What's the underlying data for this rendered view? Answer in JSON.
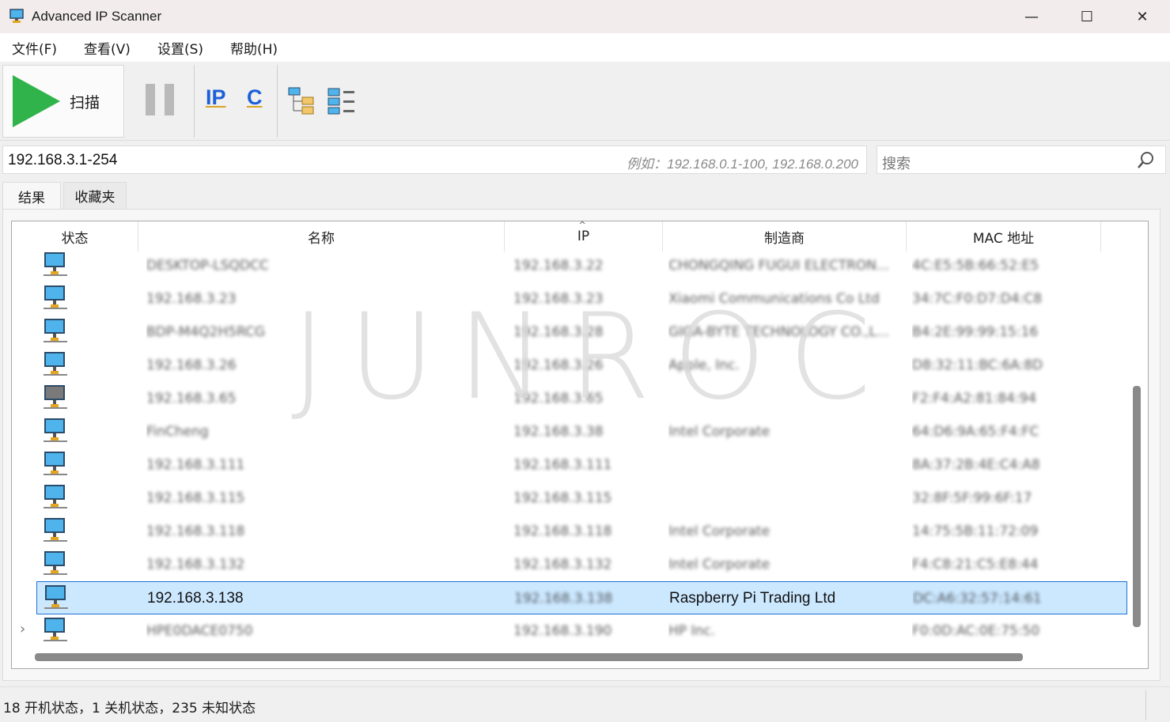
{
  "window": {
    "title": "Advanced IP Scanner",
    "minimize": "—",
    "maximize": "☐",
    "close": "✕"
  },
  "menu": [
    "文件(F)",
    "查看(V)",
    "设置(S)",
    "帮助(H)"
  ],
  "toolbar": {
    "scan_label": "扫描",
    "ip_icon": "IP",
    "c_icon": "C",
    "icons": [
      "play-icon",
      "pause-icon",
      "ip-icon",
      "c-subnet-icon",
      "tree-view-icon",
      "list-view-icon"
    ]
  },
  "ip_input": {
    "value": "192.168.3.1-254",
    "hint": "例如：192.168.0.1-100, 192.168.0.200"
  },
  "search": {
    "placeholder": "搜索"
  },
  "tabs": [
    "结果",
    "收藏夹"
  ],
  "table": {
    "columns": [
      "状态",
      "名称",
      "IP",
      "制造商",
      "MAC 地址"
    ],
    "sort_indicator": "^",
    "rows": [
      {
        "status": "on",
        "name": "DESKTOP-LSQDCC",
        "ip": "192.168.3.22",
        "vendor": "CHONGQING FUGUI ELECTRON...",
        "mac": "4C:E5:5B:66:52:E5"
      },
      {
        "status": "on",
        "name": "192.168.3.23",
        "ip": "192.168.3.23",
        "vendor": "Xiaomi Communications Co Ltd",
        "mac": "34:7C:F0:D7:D4:C8"
      },
      {
        "status": "on",
        "name": "BDP-M4Q2H5RCG",
        "ip": "192.168.3.28",
        "vendor": "GIGA-BYTE TECHNOLOGY CO.,L...",
        "mac": "B4:2E:99:99:15:16"
      },
      {
        "status": "on",
        "name": "192.168.3.26",
        "ip": "192.168.3.26",
        "vendor": "Apple, Inc.",
        "mac": "D8:32:11:BC:6A:8D"
      },
      {
        "status": "off",
        "name": "192.168.3.65",
        "ip": "192.168.3.65",
        "vendor": "",
        "mac": "F2:F4:A2:81:84:94"
      },
      {
        "status": "on",
        "name": "FinCheng",
        "ip": "192.168.3.38",
        "vendor": "Intel Corporate",
        "mac": "64:D6:9A:65:F4:FC"
      },
      {
        "status": "on",
        "name": "192.168.3.111",
        "ip": "192.168.3.111",
        "vendor": "",
        "mac": "8A:37:2B:4E:C4:A8"
      },
      {
        "status": "on",
        "name": "192.168.3.115",
        "ip": "192.168.3.115",
        "vendor": "",
        "mac": "32:8F:5F:99:6F:17"
      },
      {
        "status": "on",
        "name": "192.168.3.118",
        "ip": "192.168.3.118",
        "vendor": "Intel Corporate",
        "mac": "14:75:5B:11:72:09"
      },
      {
        "status": "on",
        "name": "192.168.3.132",
        "ip": "192.168.3.132",
        "vendor": "Intel Corporate",
        "mac": "F4:C8:21:C5:E8:44"
      },
      {
        "status": "on",
        "name": "192.168.3.138",
        "ip": "192.168.3.138",
        "vendor": "Raspberry Pi Trading Ltd",
        "mac": "DC:A6:32:57:14:61",
        "selected": true
      },
      {
        "status": "on",
        "name": "HPE0DACE0750",
        "ip": "192.168.3.190",
        "vendor": "HP Inc.",
        "mac": "F0:0D:AC:0E:75:50",
        "expandable": true
      }
    ]
  },
  "watermark": "JUNROC",
  "status_bar": {
    "text": "18 开机状态，1 关机状态，235 未知状态"
  },
  "colors": {
    "selection": "#cce8ff",
    "selection_border": "#1f73d6",
    "play": "#2fb34a",
    "screen_on": "#4fb4ec"
  }
}
